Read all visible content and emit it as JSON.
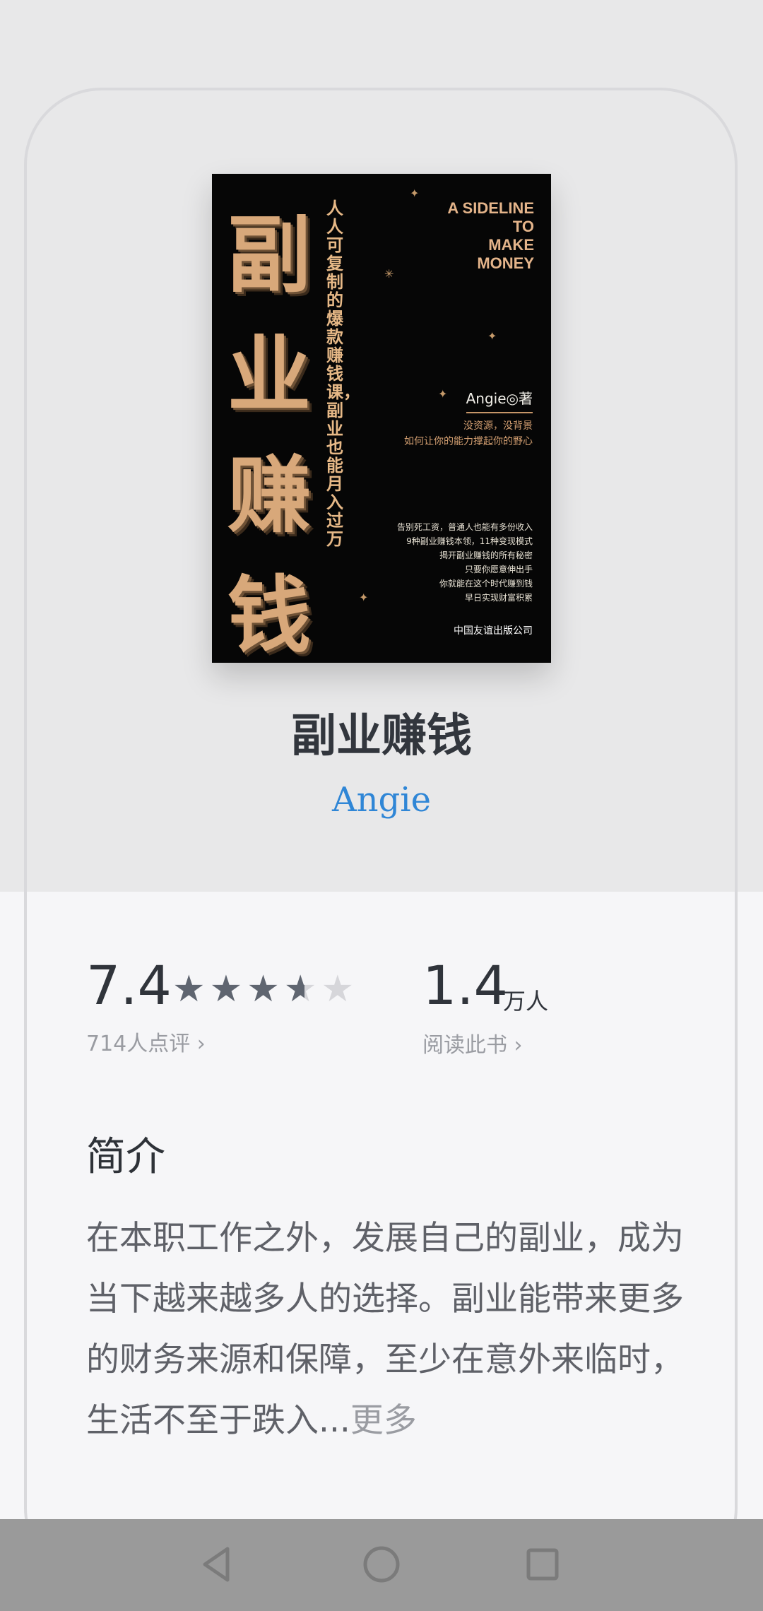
{
  "cover": {
    "title_chars": [
      "副",
      "业",
      "赚",
      "钱"
    ],
    "subtitle": "人人可复制的爆款赚钱课，副业也能月入过万",
    "english_title": "A SIDELINE\nTO\nMAKE\nMONEY",
    "author": "Angie◎著",
    "tagline": "没资源，没背景\n如何让你的能力撑起你的野心",
    "blurb": "告别死工资，普通人也能有多份收入\n9种副业赚钱本领，11种变现模式\n揭开副业赚钱的所有秘密\n只要你愿意伸出手\n你就能在这个时代赚到钱\n早日实现财富积累",
    "publisher": "中国友谊出版公司"
  },
  "book": {
    "title": "副业赚钱",
    "author": "Angie"
  },
  "rating": {
    "score": "7.4",
    "stars": 3.7,
    "review_count": "714人点评 ›"
  },
  "readers": {
    "count": "1.4",
    "unit": "万人",
    "label": "阅读此书 ›"
  },
  "intro": {
    "heading": "简介",
    "text": "在本职工作之外，发展自己的副业，成为当下越来越多人的选择。副业能带来更多的财务来源和保障，至少在意外来临时，生活不至于跌入...",
    "more_label": "更多"
  },
  "colors": {
    "accent": "#2f86d6",
    "cover_gold": "#d8a87a"
  },
  "icons": {
    "back": "triangle-back-icon",
    "home": "circle-home-icon",
    "recents": "square-recents-icon"
  }
}
